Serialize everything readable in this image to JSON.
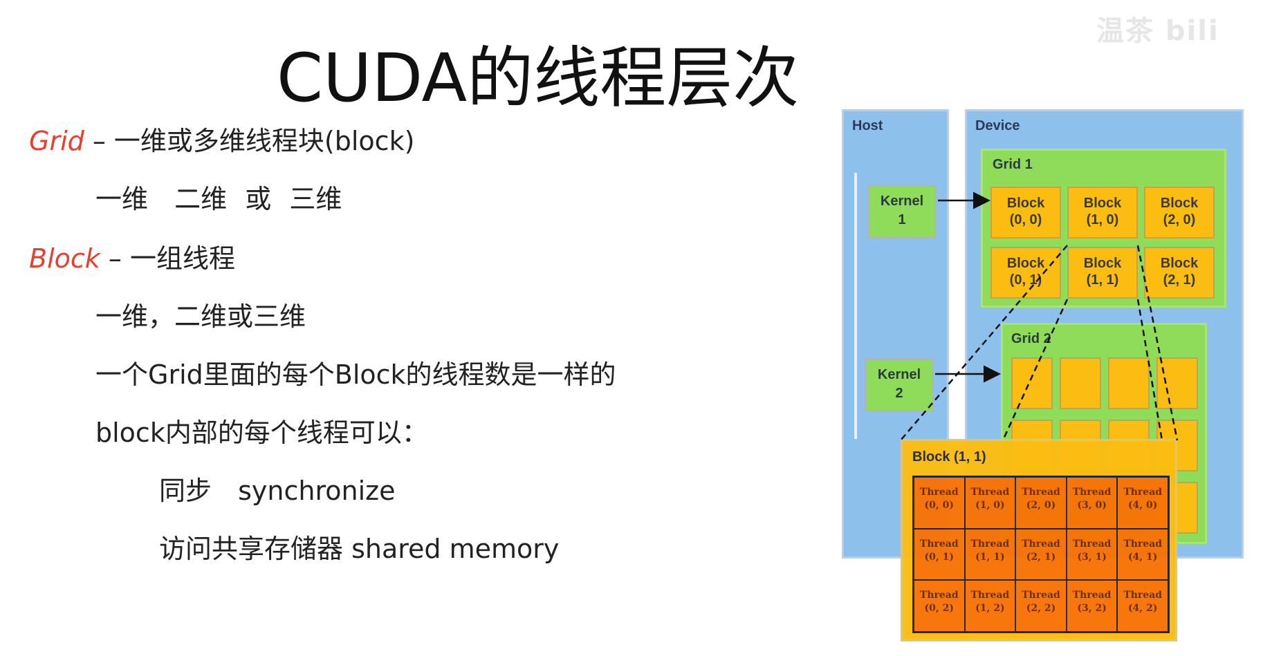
{
  "watermark": "温茶 bili",
  "title": "CUDA的线程层次",
  "text": {
    "grid_term": "Grid",
    "grid_desc": "– 一维或多维线程块(block)",
    "grid_dims": [
      "一维",
      "二维",
      "或",
      "三维"
    ],
    "block_term": "Block",
    "block_desc": "– 一组线程",
    "block_dims": "一维，二维或三维",
    "same_count": "一个Grid里面的每个Block的线程数是一样的",
    "can_do": "block内部的每个线程可以：",
    "sync_cn": "同步",
    "sync_en": "synchronize",
    "shared": "访问共享存储器 shared memory"
  },
  "diagram": {
    "host_label": "Host",
    "device_label": "Device",
    "kernels": [
      {
        "line1": "Kernel",
        "line2": "1"
      },
      {
        "line1": "Kernel",
        "line2": "2"
      }
    ],
    "grid1_label": "Grid 1",
    "grid2_label": "Grid 2",
    "blocks": [
      {
        "name": "Block",
        "idx": "(0, 0)"
      },
      {
        "name": "Block",
        "idx": "(1, 0)"
      },
      {
        "name": "Block",
        "idx": "(2, 0)"
      },
      {
        "name": "Block",
        "idx": "(0, 1)"
      },
      {
        "name": "Block",
        "idx": "(1, 1)"
      },
      {
        "name": "Block",
        "idx": "(2, 1)"
      }
    ],
    "zoom_label": "Block (1, 1)",
    "thread_word": "Thread",
    "threads": [
      "(0, 0)",
      "(1, 0)",
      "(2, 0)",
      "(3, 0)",
      "(4, 0)",
      "(0, 1)",
      "(1, 1)",
      "(2, 1)",
      "(3, 1)",
      "(4, 1)",
      "(0, 2)",
      "(1, 2)",
      "(2, 2)",
      "(3, 2)",
      "(4, 2)"
    ],
    "colors": {
      "panel": "#8ec0ec",
      "grid": "#8fdc5a",
      "block": "#fcbd12",
      "thread": "#f87306"
    }
  }
}
